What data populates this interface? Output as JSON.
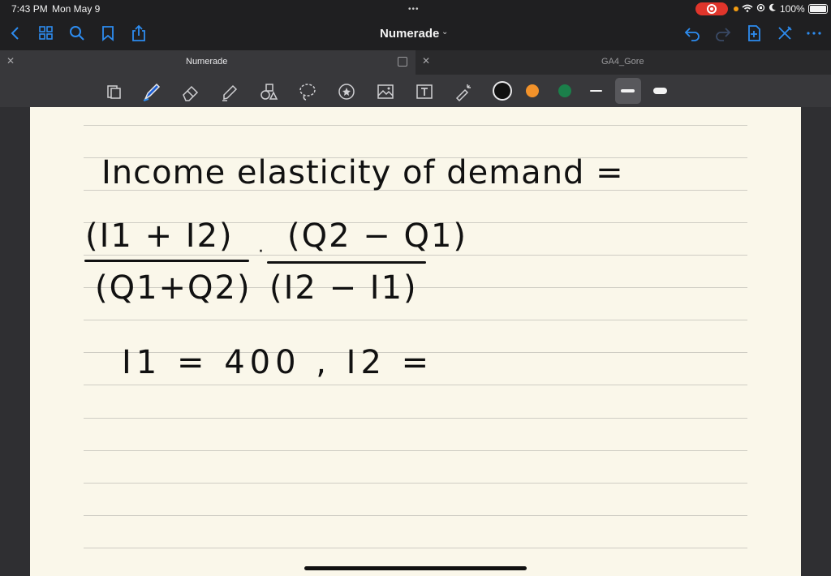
{
  "status": {
    "time": "7:43 PM",
    "date": "Mon May 9",
    "battery": "100%"
  },
  "nav": {
    "title": "Numerade",
    "icons": [
      "back-icon",
      "grid-icon",
      "search-icon",
      "bookmark-icon",
      "share-icon",
      "undo-icon",
      "redo-icon",
      "add-page-icon",
      "close-pen-icon",
      "more-icon"
    ]
  },
  "tabs": [
    {
      "label": "Numerade"
    },
    {
      "label": "GA4_Gore"
    }
  ],
  "toolbar": {
    "tools": [
      "pages-icon",
      "pen-icon",
      "eraser-icon",
      "highlighter-icon",
      "shapes-icon",
      "lasso-icon",
      "sticker-icon",
      "image-icon",
      "text-icon",
      "laser-icon"
    ],
    "colors": [
      "#111111",
      "#f2922a",
      "#1b7f4a"
    ]
  },
  "note": {
    "title": "Income elasticity of demand =",
    "fraction1_num": "(I1 + I2)",
    "fraction1_den": "(Q1+Q2)",
    "multiply": "·",
    "fraction2_num": "(Q2 − Q1)",
    "fraction2_den": "(I2 − I1)",
    "given": "I1 = 400 , I2 ="
  }
}
